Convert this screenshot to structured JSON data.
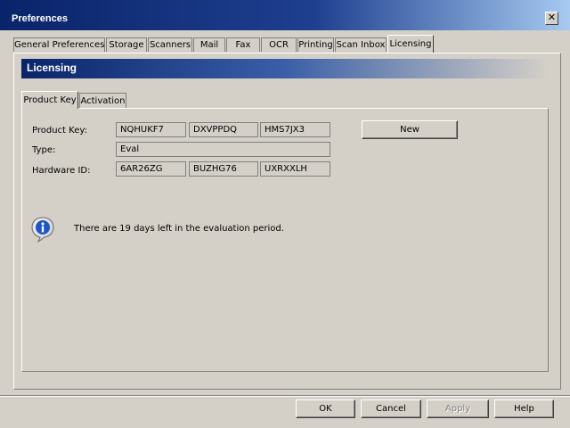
{
  "window": {
    "title": "Preferences",
    "close_glyph": "✕"
  },
  "tabs": [
    {
      "label": "General Preferences"
    },
    {
      "label": "Storage"
    },
    {
      "label": "Scanners"
    },
    {
      "label": "Mail"
    },
    {
      "label": "Fax"
    },
    {
      "label": "OCR"
    },
    {
      "label": "Printing"
    },
    {
      "label": "Scan Inbox"
    },
    {
      "label": "Licensing",
      "active": true
    }
  ],
  "section": {
    "title": "Licensing"
  },
  "inner_tabs": [
    {
      "label": "Product Key",
      "active": true
    },
    {
      "label": "Activation"
    }
  ],
  "form": {
    "product_key_label": "Product Key:",
    "product_key": [
      "NQHUKF7",
      "DXVPPDQ",
      "HMS7JX3"
    ],
    "type_label": "Type:",
    "type_value": "Eval",
    "hardware_id_label": "Hardware ID:",
    "hardware_id": [
      "6AR26ZG",
      "BUZHG76",
      "UXRXXLH"
    ],
    "new_button": "New"
  },
  "info": {
    "icon": "info-icon",
    "message": "There are 19 days left in the evaluation period."
  },
  "footer": {
    "ok": "OK",
    "cancel": "Cancel",
    "apply": "Apply",
    "help": "Help"
  }
}
